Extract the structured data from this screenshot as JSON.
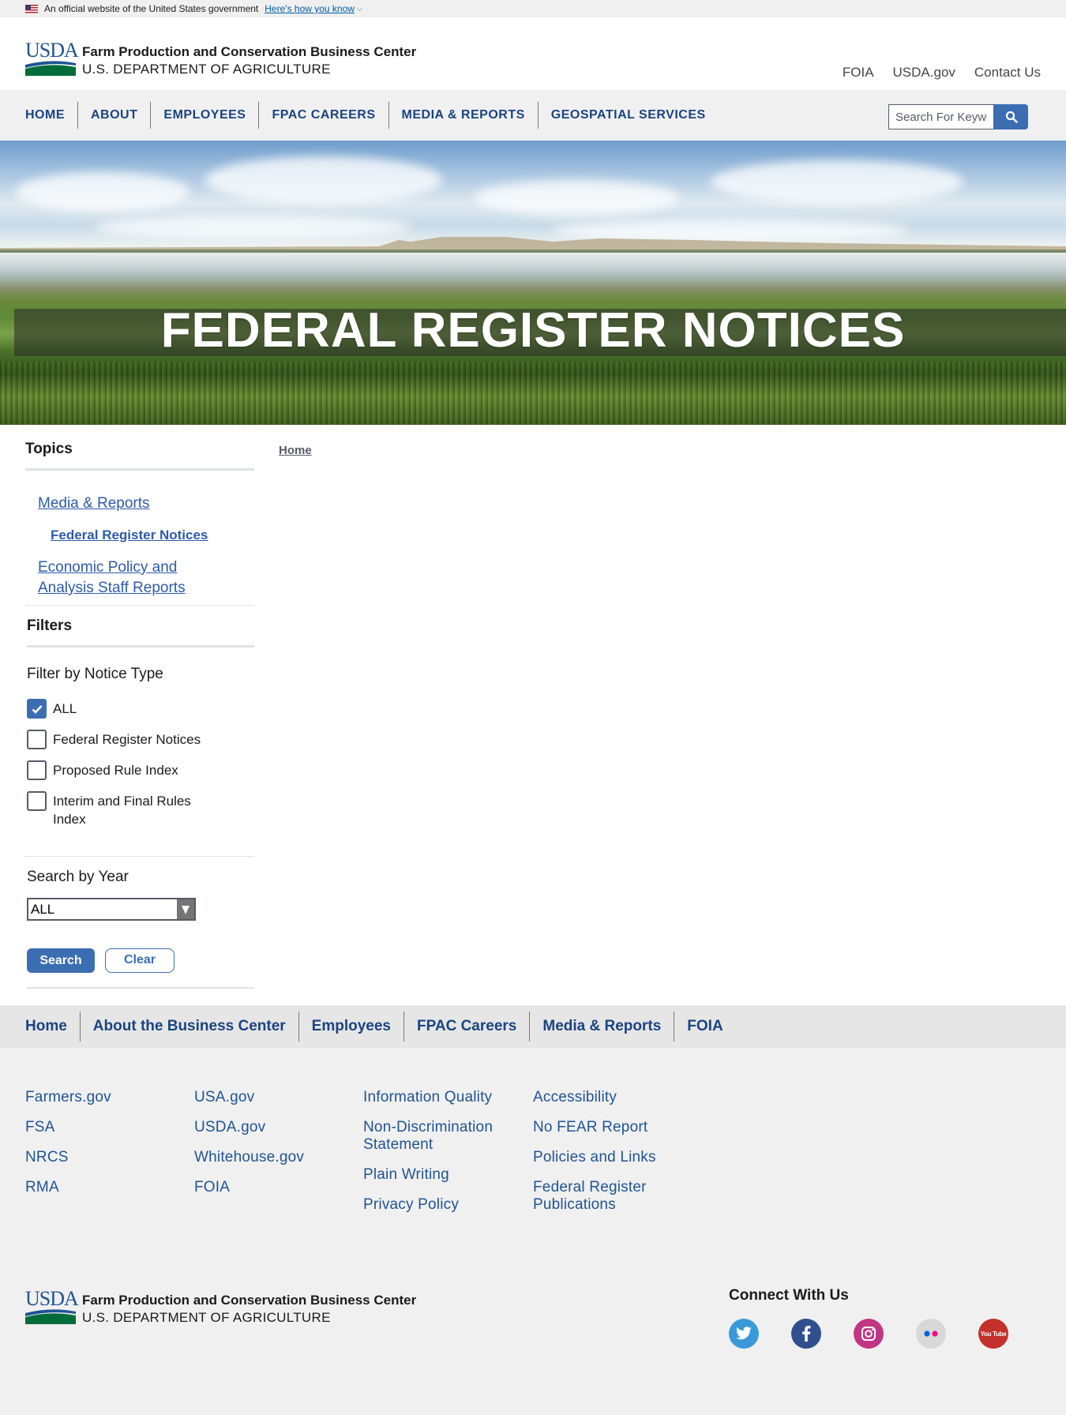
{
  "gov_banner": {
    "text": "An official website of the United States government",
    "link": "Here's how you know"
  },
  "header": {
    "logo_text": "USDA",
    "org_name": "Farm Production and Conservation Business Center",
    "org_dept": "U.S. DEPARTMENT OF AGRICULTURE",
    "utility_links": [
      "FOIA",
      "USDA.gov",
      "Contact Us"
    ]
  },
  "nav": {
    "items": [
      "HOME",
      "ABOUT",
      "EMPLOYEES",
      "FPAC CAREERS",
      "MEDIA & REPORTS",
      "GEOSPATIAL SERVICES"
    ],
    "search_placeholder": "Search For Keywords"
  },
  "hero": {
    "title": "FEDERAL REGISTER NOTICES"
  },
  "sidebar": {
    "topics_heading": "Topics",
    "topics": [
      {
        "label": "Media & Reports"
      },
      {
        "label": "Federal Register Notices"
      },
      {
        "label": "Economic Policy and Analysis Staff Reports"
      }
    ],
    "filters_heading": "Filters",
    "filter_by_label": "Filter by Notice Type",
    "notice_types": [
      {
        "label": "ALL",
        "checked": true
      },
      {
        "label": "Federal Register Notices",
        "checked": false
      },
      {
        "label": "Proposed Rule Index",
        "checked": false
      },
      {
        "label": "Interim and Final Rules Index",
        "checked": false
      }
    ],
    "year_label": "Search by Year",
    "year_selected": "ALL",
    "search_button": "Search",
    "clear_button": "Clear"
  },
  "breadcrumb": {
    "home": "Home"
  },
  "footer_nav": {
    "items": [
      "Home",
      "About the Business Center",
      "Employees",
      "FPAC Careers",
      "Media & Reports",
      "FOIA"
    ]
  },
  "footer": {
    "col1": [
      "Farmers.gov",
      "FSA",
      "NRCS",
      "RMA"
    ],
    "col2": [
      "USA.gov",
      "USDA.gov",
      "Whitehouse.gov",
      "FOIA"
    ],
    "col3": [
      "Information Quality",
      "Non-Discrimination Statement",
      "Plain Writing",
      "Privacy Policy"
    ],
    "col4": [
      "Accessibility",
      "No FEAR Report",
      "Policies and Links",
      "Federal Register Publications"
    ],
    "connect_heading": "Connect With Us",
    "social_icons": [
      "twitter-icon",
      "facebook-icon",
      "instagram-icon",
      "flickr-icon",
      "youtube-icon"
    ],
    "youtube_text": "You Tube"
  },
  "colors": {
    "nav_text": "#1a4480",
    "link_blue": "#2e5aac",
    "button_blue": "#3b6db3",
    "footer_link": "#205493"
  }
}
